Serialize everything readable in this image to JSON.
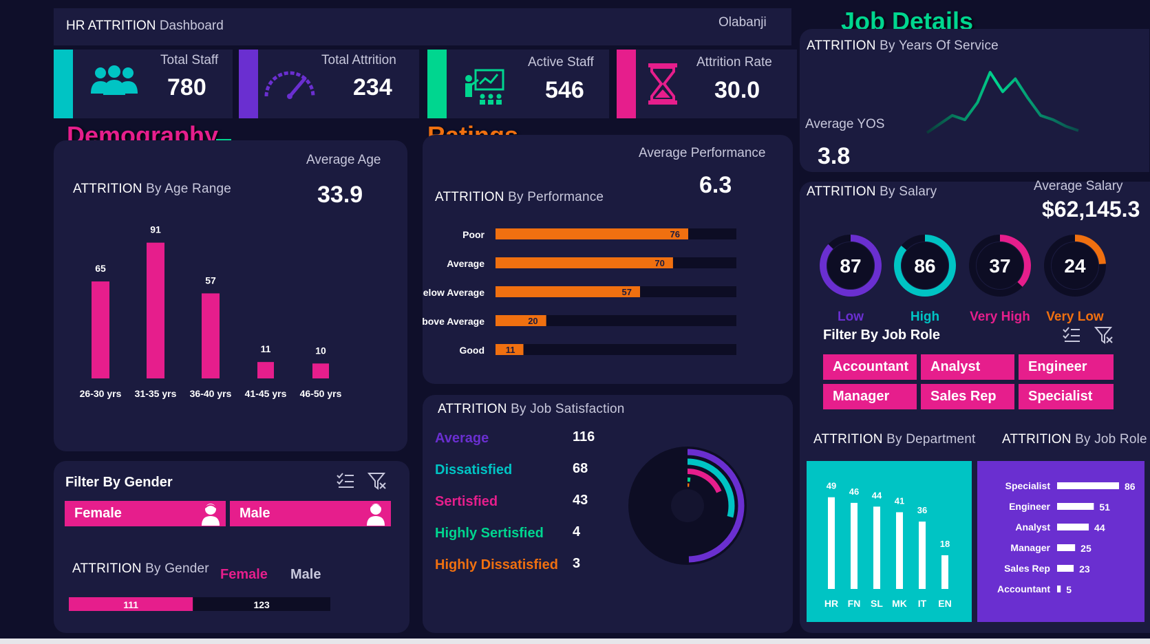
{
  "header": {
    "title_strong": "HR ATTRITION",
    "title_light": "Dashboard",
    "author": "Olabanji"
  },
  "kpis": [
    {
      "label": "Total Staff",
      "value": "780",
      "icon": "people-icon",
      "color": "#00c4c4"
    },
    {
      "label": "Total Attrition",
      "value": "234",
      "icon": "gauge-icon",
      "color": "#6a2fd0"
    },
    {
      "label": "Active Staff",
      "value": "546",
      "icon": "presenter-icon",
      "color": "#00d68f"
    },
    {
      "label": "Attrition Rate",
      "value": "30.0",
      "icon": "hourglass-icon",
      "color": "#e61e8c"
    }
  ],
  "sections": {
    "demography": "Demography",
    "ratings": "Ratings",
    "job_details": "Job Details"
  },
  "demography": {
    "avg_label": "Average Age",
    "avg_value": "33.9",
    "title_strong": "ATTRITION",
    "title_light": "By Age Range",
    "chart_data": {
      "type": "bar",
      "categories": [
        "26-30 yrs",
        "31-35 yrs",
        "36-40 yrs",
        "41-45 yrs",
        "46-50 yrs"
      ],
      "values": [
        65,
        91,
        57,
        11,
        10
      ],
      "color": "#e61e8c"
    }
  },
  "gender_filter": {
    "title": "Filter By Gender",
    "options": [
      "Female",
      "Male"
    ]
  },
  "gender_attrition": {
    "title_strong": "ATTRITION",
    "title_light": "By Gender",
    "legend_female": "Female",
    "legend_male": "Male",
    "chart_data": {
      "type": "bar",
      "categories": [
        "Female",
        "Male"
      ],
      "values": [
        111,
        123
      ]
    }
  },
  "ratings": {
    "avg_label": "Average Performance",
    "avg_value": "6.3",
    "title_strong": "ATTRITION",
    "title_light": "By Performance",
    "chart_data": {
      "type": "bar",
      "categories": [
        "Poor",
        "Average",
        "Below Average",
        "Above Average",
        "Good"
      ],
      "values": [
        76,
        70,
        57,
        20,
        11
      ],
      "xlim": [
        0,
        95
      ],
      "color": "#f07010"
    }
  },
  "satisfaction": {
    "title_strong": "ATTRITION",
    "title_light": "By Job Satisfaction",
    "rows": [
      {
        "label": "Average",
        "value": "116",
        "color": "#6a2fd0"
      },
      {
        "label": "Dissatisfied",
        "value": "68",
        "color": "#00c4c4"
      },
      {
        "label": "Sertisfied",
        "value": "43",
        "color": "#e61e8c"
      },
      {
        "label": "Highly Sertisfied",
        "value": "4",
        "color": "#00d68f"
      },
      {
        "label": "Highly Dissatisfied",
        "value": "3",
        "color": "#f07010"
      }
    ],
    "chart_data": {
      "type": "pie",
      "categories": [
        "Average",
        "Dissatisfied",
        "Sertisfied",
        "Highly Sertisfied",
        "Highly Dissatisfied"
      ],
      "values": [
        116,
        68,
        43,
        4,
        3
      ]
    }
  },
  "yos": {
    "title_strong": "ATTRITION",
    "title_light": "By Years Of Service",
    "avg_label": "Average YOS",
    "avg_value": "3.8",
    "chart_data": {
      "type": "line",
      "values": [
        2,
        10,
        18,
        14,
        30,
        58,
        40,
        52,
        34,
        18,
        14,
        8,
        4
      ]
    }
  },
  "salary": {
    "title_strong": "ATTRITION",
    "title_light": "By Salary",
    "avg_label": "Average Salary",
    "avg_value": "$62,145.3",
    "chart_data": {
      "type": "pie",
      "categories": [
        "Low",
        "High",
        "Very  High",
        "Very Low"
      ],
      "values": [
        87,
        86,
        37,
        24
      ],
      "colors": [
        "#6a2fd0",
        "#00c4c4",
        "#e61e8c",
        "#f07010"
      ]
    }
  },
  "role_filter": {
    "title": "Filter By Job Role",
    "options": [
      "Accountant",
      "Analyst",
      "Engineer",
      "Manager",
      "Sales Rep",
      "Specialist"
    ]
  },
  "department": {
    "title_strong": "ATTRITION",
    "title_light": "By Department",
    "chart_data": {
      "type": "bar",
      "categories": [
        "HR",
        "FN",
        "SL",
        "MK",
        "IT",
        "EN"
      ],
      "values": [
        49,
        46,
        44,
        41,
        36,
        18
      ]
    }
  },
  "job_role": {
    "title_strong": "ATTRITION",
    "title_light": "By Job Role",
    "chart_data": {
      "type": "bar",
      "categories": [
        "Specialist",
        "Engineer",
        "Analyst",
        "Manager",
        "Sales Rep",
        "Accountant"
      ],
      "values": [
        86,
        51,
        44,
        25,
        23,
        5
      ]
    }
  }
}
